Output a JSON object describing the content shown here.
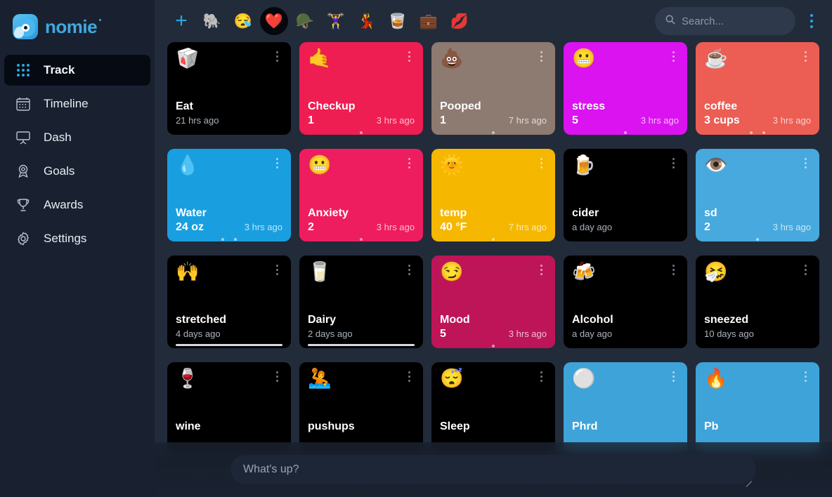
{
  "brand": {
    "name": "nomie",
    "logo_icon": "nomie-whale-logo"
  },
  "sidebar": {
    "items": [
      {
        "label": "Track",
        "icon": "dot-grid-icon",
        "active": true
      },
      {
        "label": "Timeline",
        "icon": "calendar-icon",
        "active": false
      },
      {
        "label": "Dash",
        "icon": "dashboard-icon",
        "active": false
      },
      {
        "label": "Goals",
        "icon": "award-ribbon-icon",
        "active": false
      },
      {
        "label": "Awards",
        "icon": "trophy-icon",
        "active": false
      },
      {
        "label": "Settings",
        "icon": "gear-icon",
        "active": false
      }
    ]
  },
  "topbar": {
    "add_label": "+",
    "boards": [
      {
        "emoji": "🐘",
        "name": "elephant-board",
        "selected": false
      },
      {
        "emoji": "😪",
        "name": "sleepy-board",
        "selected": false
      },
      {
        "emoji": "❤️",
        "name": "heart-board",
        "selected": true
      },
      {
        "emoji": "🪖",
        "name": "helmet-board",
        "selected": false
      },
      {
        "emoji": "🏋️‍♀️",
        "name": "weightlifter-board",
        "selected": false
      },
      {
        "emoji": "💃",
        "name": "dancer-board",
        "selected": false
      },
      {
        "emoji": "🥃",
        "name": "whiskey-board",
        "selected": false
      },
      {
        "emoji": "💼",
        "name": "briefcase-board",
        "selected": false
      },
      {
        "emoji": "💋",
        "name": "kiss-board",
        "selected": false
      }
    ],
    "search": {
      "placeholder": "Search...",
      "value": "",
      "icon": "search-icon"
    },
    "menu_icon": "kebab-menu-icon"
  },
  "colors": {
    "sidebar_bg": "#192131",
    "main_bg": "#222b3a",
    "accent": "#2aa7e2",
    "card_default": "#000000"
  },
  "trackers": [
    {
      "emoji": "🥡",
      "title": "Eat",
      "value": "",
      "time": "21 hrs ago",
      "bg": "#000000",
      "text_light": false,
      "dots": 0,
      "bar": false
    },
    {
      "emoji": "🤙",
      "title": "Checkup",
      "value": "1",
      "time": "3 hrs ago",
      "bg": "#ee1d52",
      "text_light": true,
      "dots": 1,
      "bar": false
    },
    {
      "emoji": "💩",
      "title": "Pooped",
      "value": "1",
      "time": "7 hrs ago",
      "bg": "#8d7a70",
      "text_light": true,
      "dots": 1,
      "bar": false
    },
    {
      "emoji": "😬",
      "title": "stress",
      "value": "5",
      "time": "3 hrs ago",
      "bg": "#da13f0",
      "text_light": true,
      "dots": 1,
      "bar": false
    },
    {
      "emoji": "☕",
      "title": "coffee",
      "value": "3 cups",
      "time": "3 hrs ago",
      "bg": "#ec5d53",
      "text_light": true,
      "dots": 2,
      "bar": false
    },
    {
      "emoji": "💧",
      "title": "Water",
      "value": "24 oz",
      "time": "3 hrs ago",
      "bg": "#199fe0",
      "text_light": true,
      "dots": 2,
      "bar": false
    },
    {
      "emoji": "😬",
      "title": "Anxiety",
      "value": "2",
      "time": "3 hrs ago",
      "bg": "#ee1d5f",
      "text_light": true,
      "dots": 1,
      "bar": false
    },
    {
      "emoji": "🌞",
      "title": "temp",
      "value": "40 °F",
      "time": "7 hrs ago",
      "bg": "#f5b700",
      "text_light": true,
      "dots": 1,
      "bar": false
    },
    {
      "emoji": "🍺",
      "title": "cider",
      "value": "",
      "time": "a day ago",
      "bg": "#000000",
      "text_light": false,
      "dots": 0,
      "bar": false
    },
    {
      "emoji": "👁️",
      "title": "sd",
      "value": "2",
      "time": "3 hrs ago",
      "bg": "#47a9dd",
      "text_light": true,
      "dots": 1,
      "bar": false
    },
    {
      "emoji": "🙌",
      "title": "stretched",
      "value": "",
      "time": "4 days ago",
      "bg": "#000000",
      "text_light": false,
      "dots": 0,
      "bar": true
    },
    {
      "emoji": "🥛",
      "title": "Dairy",
      "value": "",
      "time": "2 days ago",
      "bg": "#000000",
      "text_light": false,
      "dots": 0,
      "bar": true
    },
    {
      "emoji": "😏",
      "title": "Mood",
      "value": "5",
      "time": "3 hrs ago",
      "bg": "#be1558",
      "text_light": true,
      "dots": 1,
      "bar": false
    },
    {
      "emoji": "🍻",
      "title": "Alcohol",
      "value": "",
      "time": "a day ago",
      "bg": "#000000",
      "text_light": false,
      "dots": 0,
      "bar": false
    },
    {
      "emoji": "🤧",
      "title": "sneezed",
      "value": "",
      "time": "10 days ago",
      "bg": "#000000",
      "text_light": false,
      "dots": 0,
      "bar": false
    },
    {
      "emoji": "🍷",
      "title": "wine",
      "value": "",
      "time": "",
      "bg": "#000000",
      "text_light": false,
      "dots": 0,
      "bar": false
    },
    {
      "emoji": "🤽",
      "title": "pushups",
      "value": "",
      "time": "",
      "bg": "#000000",
      "text_light": false,
      "dots": 0,
      "bar": false
    },
    {
      "emoji": "😴",
      "title": "Sleep",
      "value": "",
      "time": "",
      "bg": "#000000",
      "text_light": false,
      "dots": 0,
      "bar": false
    },
    {
      "emoji": "⚪",
      "title": "Phrd",
      "value": "",
      "time": "",
      "bg": "#3ea3d8",
      "text_light": true,
      "dots": 0,
      "bar": false
    },
    {
      "emoji": "🔥",
      "title": "Pb",
      "value": "",
      "time": "",
      "bg": "#3ea3d8",
      "text_light": true,
      "dots": 0,
      "bar": false
    }
  ],
  "note": {
    "placeholder": "What's up?",
    "value": ""
  }
}
